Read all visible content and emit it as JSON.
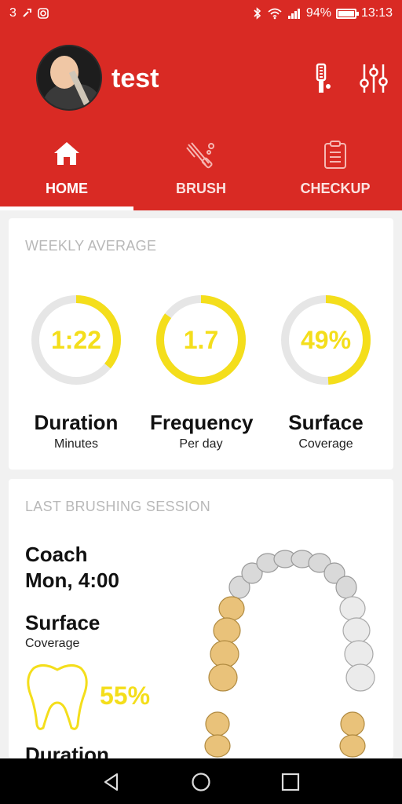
{
  "status_bar": {
    "left_text": "3",
    "battery": "94%",
    "time": "13:13",
    "icons": [
      "wrench-icon",
      "instagram-icon",
      "bluetooth-icon",
      "wifi-icon",
      "signal-icon",
      "battery-icon"
    ]
  },
  "header": {
    "username": "test",
    "action_icons": [
      "toothbrush-icon",
      "settings-sliders-icon"
    ]
  },
  "tabs": [
    {
      "label": "HOME",
      "icon": "home-icon",
      "active": true
    },
    {
      "label": "BRUSH",
      "icon": "brush-icon",
      "active": false
    },
    {
      "label": "CHECKUP",
      "icon": "clipboard-icon",
      "active": false
    }
  ],
  "weekly_average": {
    "title": "WEEKLY AVERAGE",
    "metrics": [
      {
        "value": "1:22",
        "name": "Duration",
        "sub": "Minutes",
        "fill": 0.36
      },
      {
        "value": "1.7",
        "name": "Frequency",
        "sub": "Per day",
        "fill": 0.85
      },
      {
        "value": "49%",
        "name": "Surface",
        "sub": "Coverage",
        "fill": 0.49
      }
    ]
  },
  "last_session": {
    "title": "LAST BRUSHING SESSION",
    "mode_line1": "Coach",
    "mode_line2": "Mon, 4:00",
    "surface_label": "Surface",
    "surface_sub": "Coverage",
    "surface_value": "55%",
    "next_label": "Duration"
  },
  "colors": {
    "brand_red": "#d92a24",
    "accent_yellow": "#f4de1b",
    "ring_track": "#e6e6e6"
  },
  "nav_bar": {
    "buttons": [
      "back-icon",
      "home-circle-icon",
      "recents-icon"
    ]
  }
}
